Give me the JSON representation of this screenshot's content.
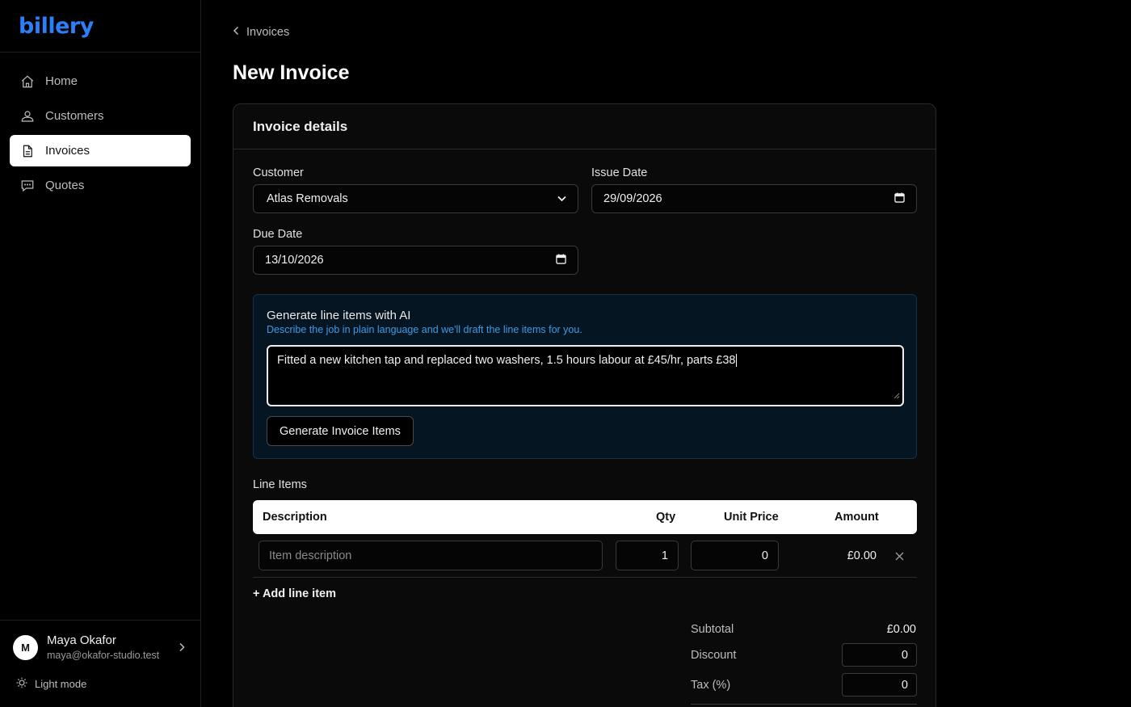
{
  "brand": {
    "logo_text": "billery",
    "accent": "#2d7ff9"
  },
  "sidebar": {
    "items": [
      {
        "label": "Home",
        "icon": "home-icon"
      },
      {
        "label": "Customers",
        "icon": "users-icon"
      },
      {
        "label": "Invoices",
        "icon": "document-icon",
        "active": true
      },
      {
        "label": "Quotes",
        "icon": "chat-icon"
      }
    ],
    "user": {
      "initial": "M",
      "name": "Maya Okafor",
      "email": "maya@okafor-studio.test"
    },
    "mode_toggle": "Light mode"
  },
  "breadcrumb": {
    "label": "Invoices"
  },
  "page_title": "New Invoice",
  "card": {
    "title": "Invoice details",
    "customer": {
      "label": "Customer",
      "value": "Atlas Removals"
    },
    "issue_date": {
      "label": "Issue Date",
      "value": "29/09/2026"
    },
    "due_date": {
      "label": "Due Date",
      "value": "13/10/2026"
    },
    "ai": {
      "title": "Generate line items with AI",
      "subtitle": "Describe the job in plain language and we'll draft the line items for you.",
      "prompt": "Fitted a new kitchen tap and replaced two washers, 1.5 hours labour at £45/hr, parts £38",
      "button": "Generate Invoice Items"
    },
    "line_items": {
      "label": "Line Items",
      "headers": {
        "description": "Description",
        "qty": "Qty",
        "unit_price": "Unit Price",
        "amount": "Amount"
      },
      "rows": [
        {
          "description_placeholder": "Item description",
          "qty": "1",
          "unit_price": "0",
          "amount": "£0.00"
        }
      ],
      "add_label": "+ Add line item"
    },
    "totals": {
      "subtotal_label": "Subtotal",
      "subtotal_value": "£0.00",
      "discount_label": "Discount",
      "discount_value": "0",
      "tax_label": "Tax (%)",
      "tax_value": "0"
    }
  }
}
